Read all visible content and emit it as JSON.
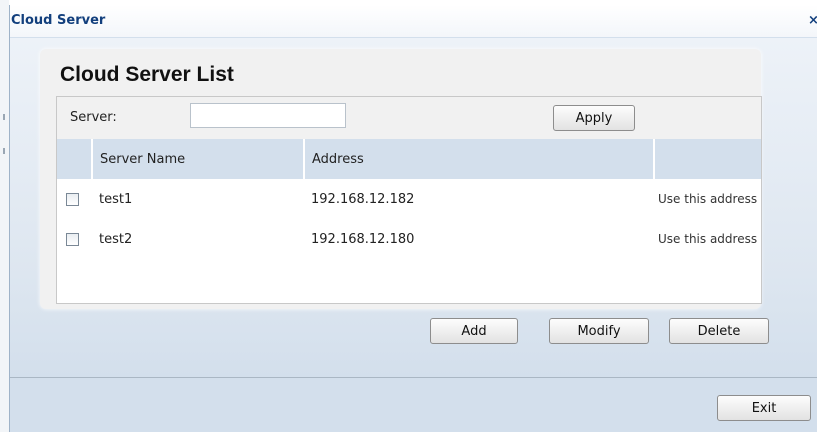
{
  "window": {
    "title": "Cloud Server",
    "close_label": "×"
  },
  "card": {
    "title": "Cloud Server List"
  },
  "search": {
    "label": "Server:",
    "value": "",
    "placeholder": "",
    "apply_label": "Apply"
  },
  "table": {
    "columns": [
      "",
      "Server Name",
      "Address",
      ""
    ],
    "rows": [
      {
        "checked": false,
        "name": "test1",
        "address": "192.168.12.182",
        "action": "Use this address"
      },
      {
        "checked": false,
        "name": "test2",
        "address": "192.168.12.180",
        "action": "Use this address"
      }
    ]
  },
  "actions": {
    "add_label": "Add",
    "modify_label": "Modify",
    "delete_label": "Delete"
  },
  "footer": {
    "exit_label": "Exit"
  }
}
